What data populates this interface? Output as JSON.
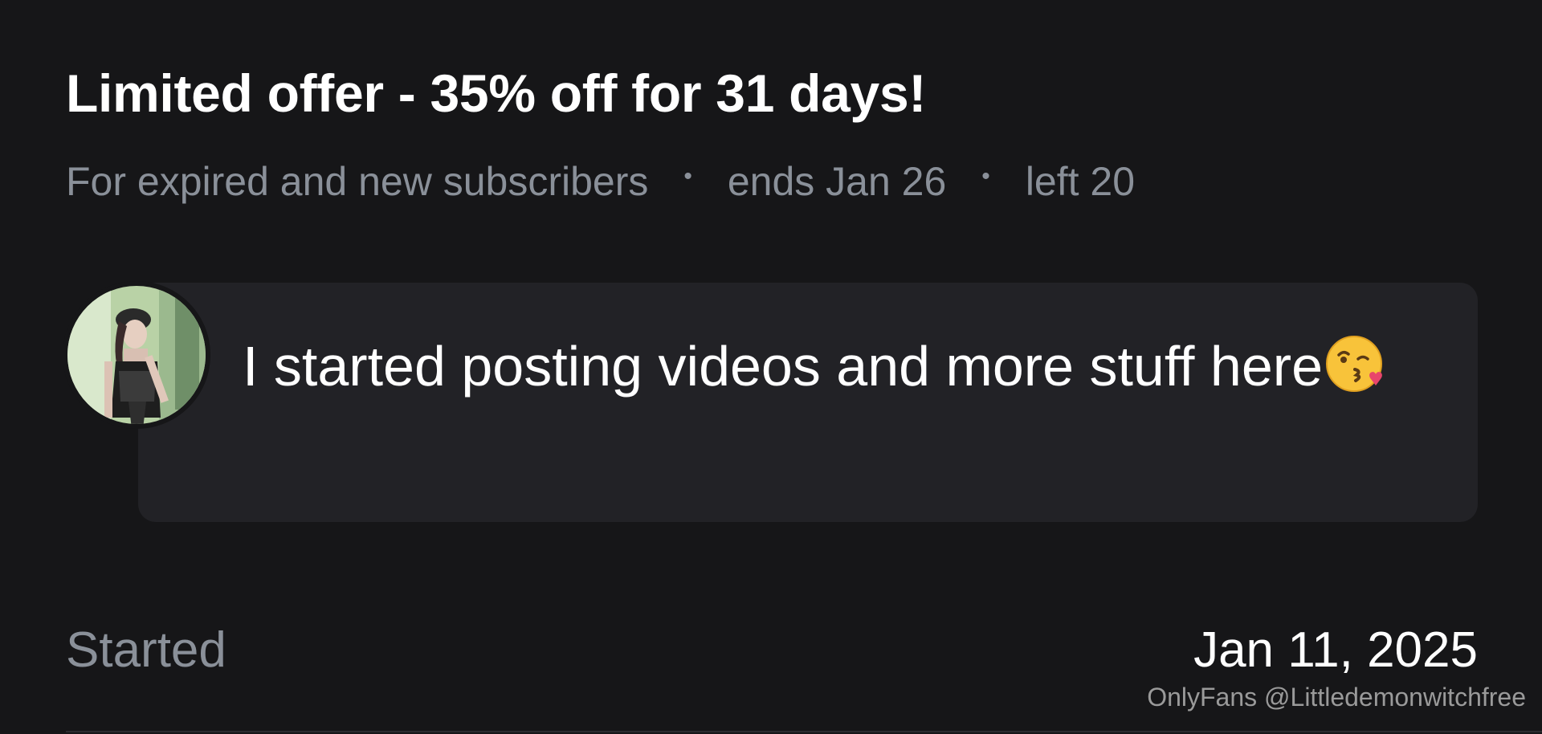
{
  "offer": {
    "title": "Limited offer - 35% off for 31 days!",
    "audience": "For expired and new subscribers",
    "ends": "ends Jan 26",
    "left": "left 20"
  },
  "message": {
    "text": "I started posting videos and more stuff here",
    "emoji_icon": "face-blowing-a-kiss-icon"
  },
  "started": {
    "label": "Started",
    "date": "Jan 11, 2025"
  },
  "watermark": "OnlyFans @Littledemonwitchfree",
  "colors": {
    "background": "#161618",
    "card": "#222226",
    "muted_text": "#8a9099",
    "text": "#ffffff"
  }
}
